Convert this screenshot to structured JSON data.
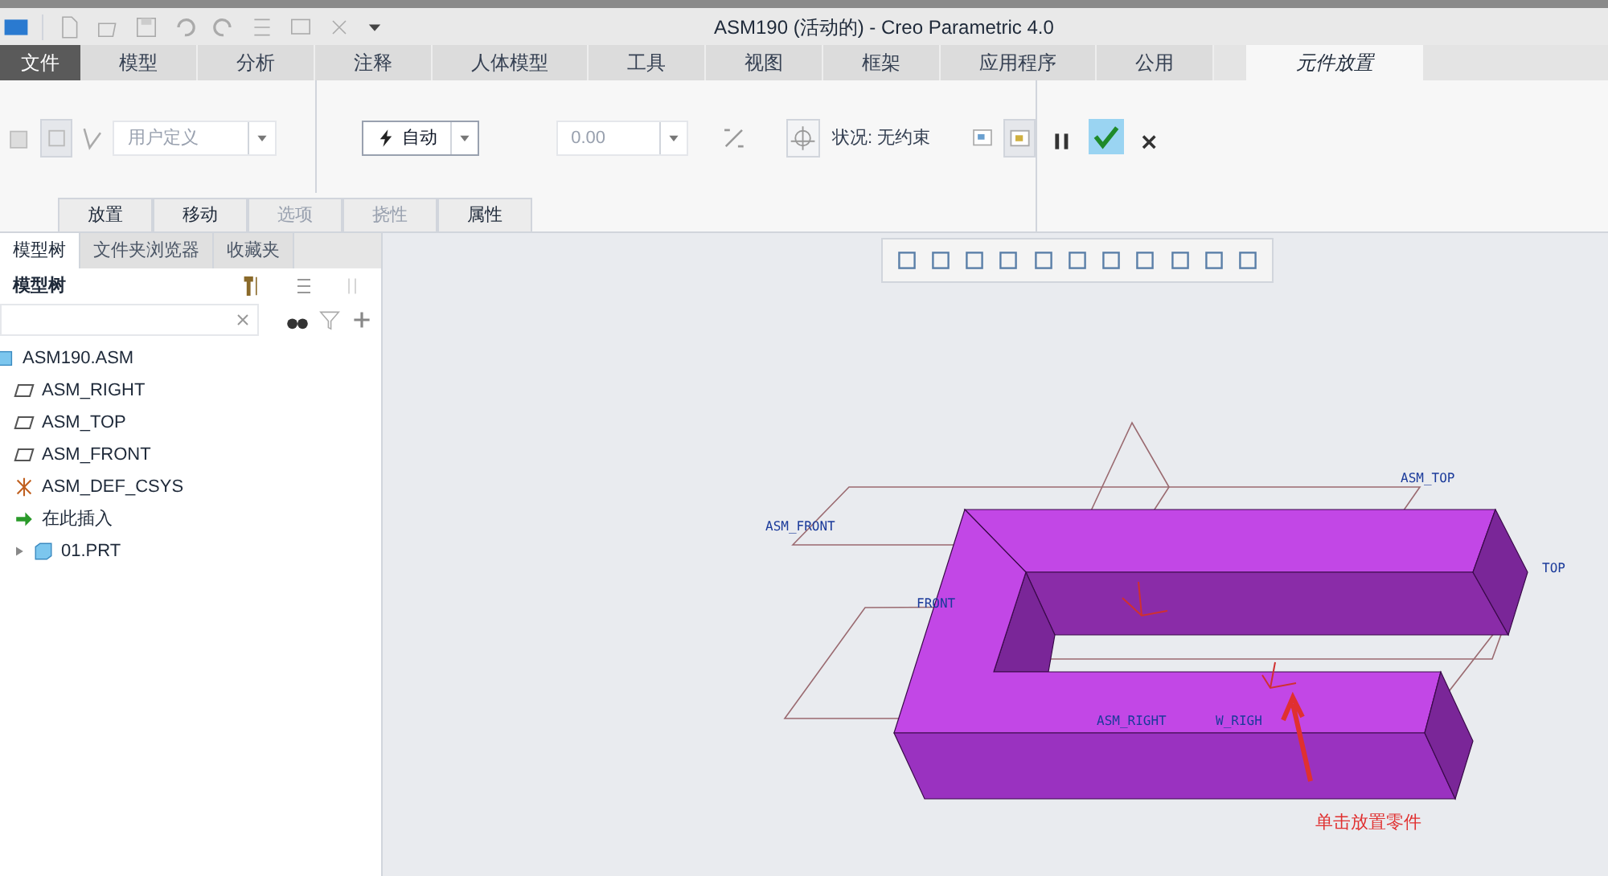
{
  "window": {
    "title": "ASM190 (活动的) - Creo Parametric 4.0"
  },
  "menu_tabs": [
    {
      "label": "文件",
      "selected": false,
      "kind": "file"
    },
    {
      "label": "模型",
      "selected": false,
      "kind": "tab"
    },
    {
      "label": "分析",
      "selected": false,
      "kind": "tab"
    },
    {
      "label": "注释",
      "selected": false,
      "kind": "tab"
    },
    {
      "label": "人体模型",
      "selected": false,
      "kind": "tab"
    },
    {
      "label": "工具",
      "selected": false,
      "kind": "tab"
    },
    {
      "label": "视图",
      "selected": false,
      "kind": "tab"
    },
    {
      "label": "框架",
      "selected": false,
      "kind": "tab"
    },
    {
      "label": "应用程序",
      "selected": false,
      "kind": "tab"
    },
    {
      "label": "公用",
      "selected": false,
      "kind": "tab"
    },
    {
      "label": "元件放置",
      "selected": true,
      "kind": "tab"
    }
  ],
  "ribbon": {
    "constraint_set": {
      "value": "用户定义",
      "disabled": true
    },
    "constraint_type": {
      "value": "自动"
    },
    "offset": {
      "value": "0.00",
      "disabled": true
    },
    "status": "状况: 无约束"
  },
  "subtabs": [
    {
      "label": "放置",
      "disabled": false
    },
    {
      "label": "移动",
      "disabled": false
    },
    {
      "label": "选项",
      "disabled": true
    },
    {
      "label": "挠性",
      "disabled": true
    },
    {
      "label": "属性",
      "disabled": false
    }
  ],
  "panel_tabs": [
    {
      "label": "模型树",
      "selected": true
    },
    {
      "label": "文件夹浏览器",
      "selected": false
    },
    {
      "label": "收藏夹",
      "selected": false
    }
  ],
  "tree_title": "模型树",
  "tree": [
    {
      "label": "ASM190.ASM",
      "kind": "assembly",
      "children": [
        {
          "label": "ASM_RIGHT",
          "kind": "plane"
        },
        {
          "label": "ASM_TOP",
          "kind": "plane"
        },
        {
          "label": "ASM_FRONT",
          "kind": "plane"
        },
        {
          "label": "ASM_DEF_CSYS",
          "kind": "csys"
        },
        {
          "label": "在此插入",
          "kind": "insert"
        },
        {
          "label": "01.PRT",
          "kind": "part",
          "expanded": false
        }
      ]
    }
  ],
  "viewport": {
    "labels": [
      "ASM_FRONT",
      "ASM_TOP",
      "TOP",
      "FRONT",
      "ASM_RIGHT",
      "W_RIGH"
    ],
    "annotation": "单击放置零件"
  }
}
